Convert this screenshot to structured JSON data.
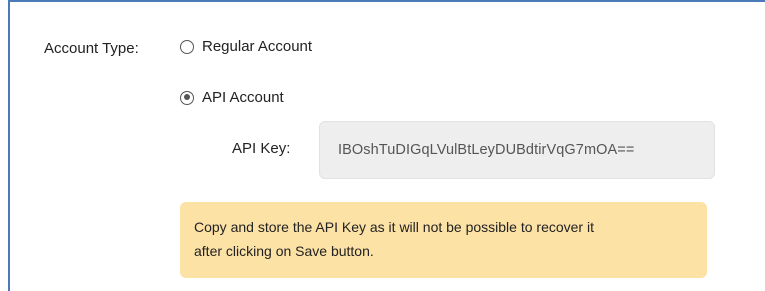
{
  "form": {
    "account_type_label": "Account Type:",
    "options": [
      {
        "label": "Regular Account",
        "selected": false
      },
      {
        "label": "API Account",
        "selected": true
      }
    ],
    "api_key_label": "API Key:",
    "api_key_value": "IBOshTuDIGqLVulBtLeyDUBdtirVqG7mOA==",
    "notice_line1": "Copy and store the API Key as it will not be possible to recover it",
    "notice_line2": "after clicking on Save button."
  },
  "colors": {
    "panel_border": "#4a7ab8",
    "field_background": "#eeeeee",
    "notice_background": "#fde2a6"
  }
}
